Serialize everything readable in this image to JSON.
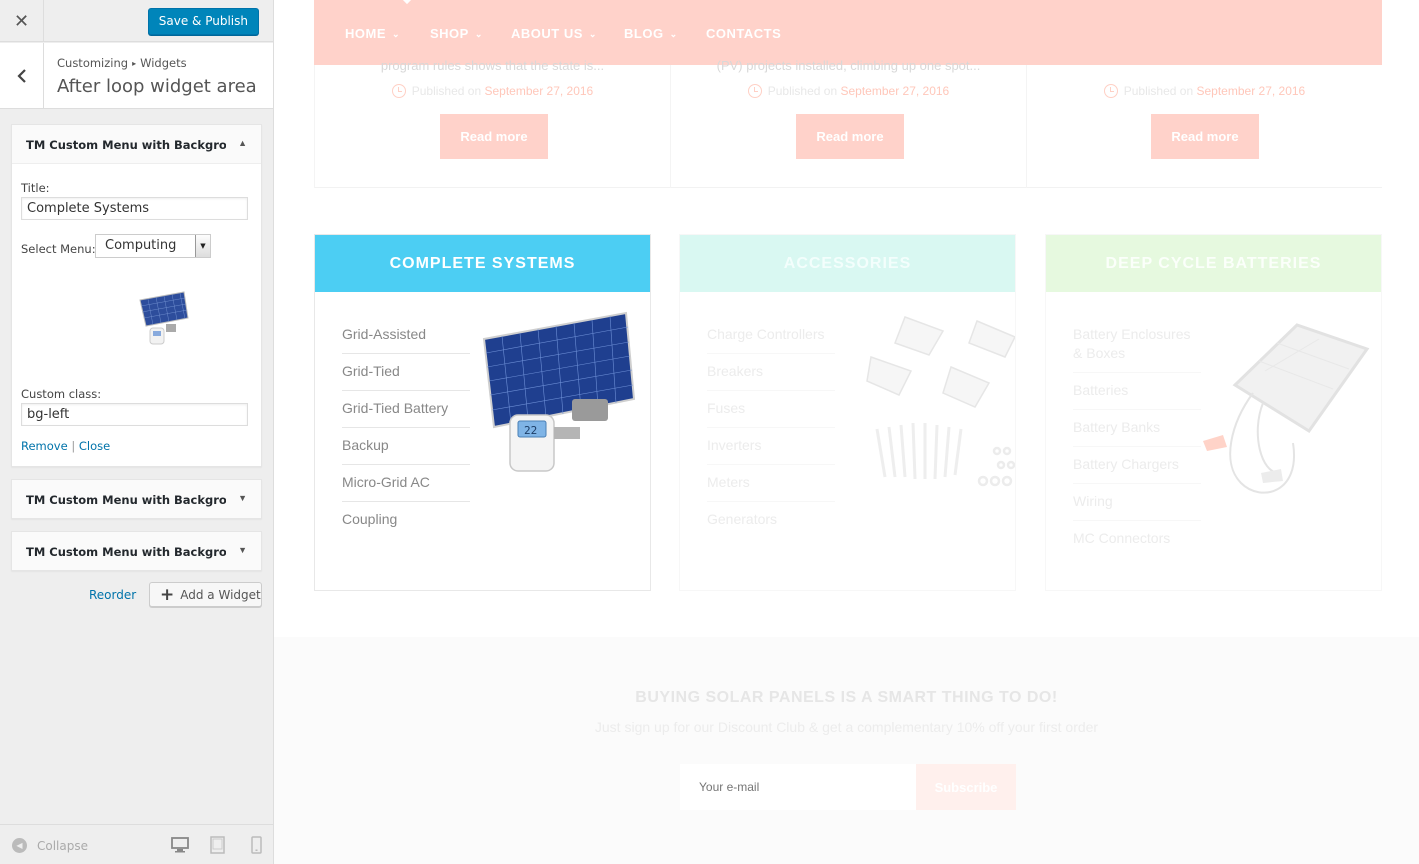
{
  "customizer": {
    "close_icon": "close-icon",
    "save_label": "Save & Publish",
    "breadcrumb": {
      "root": "Customizing",
      "section": "Widgets"
    },
    "section_title": "After loop widget area",
    "widgets": [
      {
        "title": "TM Custom Menu with Backgrou...",
        "expanded": true,
        "fields": {
          "title_label": "Title:",
          "title_value": "Complete Systems",
          "menu_label": "Select Menu:",
          "menu_value": "Computing",
          "class_label": "Custom class:",
          "class_value": "bg-left"
        },
        "remove_label": "Remove",
        "separator": "|",
        "close_label": "Close"
      },
      {
        "title": "TM Custom Menu with Backgrou...",
        "expanded": false
      },
      {
        "title": "TM Custom Menu with Backgrou...",
        "expanded": false
      }
    ],
    "reorder_label": "Reorder",
    "add_widget_label": "Add a Widget",
    "collapse_label": "Collapse"
  },
  "preview": {
    "nav": [
      {
        "label": "HOME",
        "has_dropdown": true
      },
      {
        "label": "SHOP",
        "has_dropdown": true
      },
      {
        "label": "ABOUT US",
        "has_dropdown": true
      },
      {
        "label": "BLOG",
        "has_dropdown": true
      },
      {
        "label": "CONTACTS",
        "has_dropdown": false
      }
    ],
    "posts": [
      {
        "excerpt": "program rules shows that the state is...",
        "published": "Published on",
        "date": "September 27, 2016",
        "read_more": "Read more"
      },
      {
        "excerpt": "(PV) projects installed, climbing up one spot...",
        "published": "Published on",
        "date": "September 27, 2016",
        "read_more": "Read more"
      },
      {
        "excerpt": "",
        "published": "Published on",
        "date": "September 27, 2016",
        "read_more": "Read more"
      }
    ],
    "categories": [
      {
        "title": "COMPLETE SYSTEMS",
        "color": "#4ccef3",
        "items": [
          "Grid-Assisted",
          "Grid-Tied",
          "Grid-Tied Battery",
          "Backup",
          "Micro-Grid AC",
          "Coupling"
        ]
      },
      {
        "title": "ACCESSORIES",
        "color": "#d9f8f2",
        "items": [
          "Charge Controllers",
          "Breakers",
          "Fuses",
          "Inverters",
          "Meters",
          "Generators"
        ]
      },
      {
        "title": "DEEP CYCLE BATTERIES",
        "color": "#e6f9df",
        "items": [
          "Battery Enclosures & Boxes",
          "Batteries",
          "Battery Banks",
          "Battery Chargers",
          "Wiring",
          "MC Connectors"
        ]
      }
    ],
    "newsletter": {
      "title": "BUYING SOLAR PANELS IS A SMART THING TO DO!",
      "subtitle": "Just sign up for our Discount Club & get a complementary 10% off your first order",
      "email_placeholder": "Your e-mail",
      "subscribe_label": "Subscribe"
    },
    "accent_color": "#ffd2ca"
  }
}
